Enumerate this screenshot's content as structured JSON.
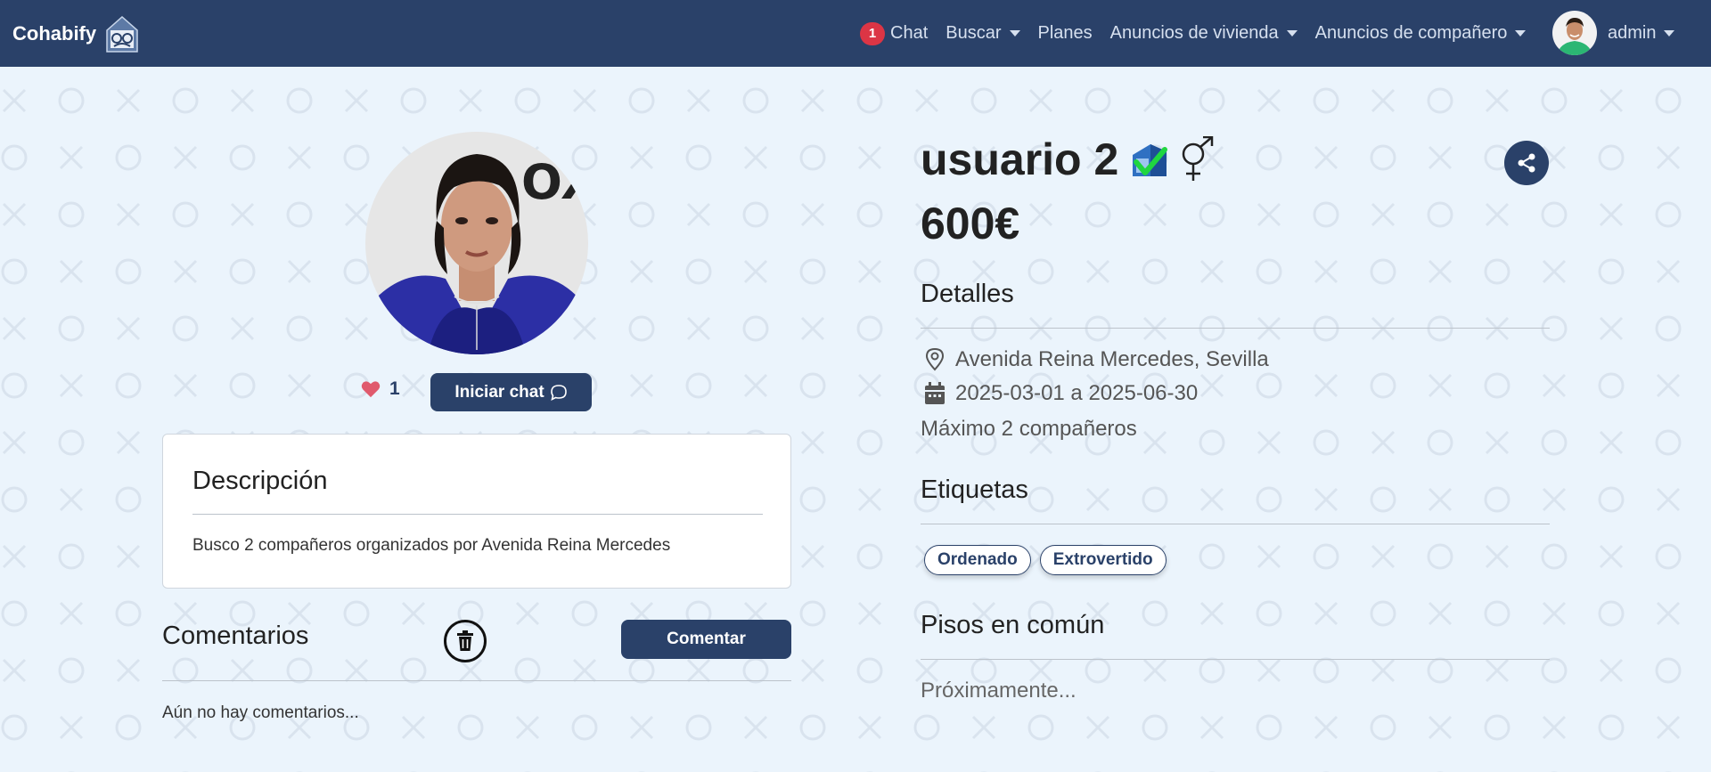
{
  "navbar": {
    "brand": "Cohabify",
    "chat_badge": "1",
    "chat_label": "Chat",
    "search_label": "Buscar",
    "plans_label": "Planes",
    "housing_ads_label": "Anuncios de vivienda",
    "roommate_ads_label": "Anuncios de compañero",
    "user_name": "admin"
  },
  "profile": {
    "likes": "1",
    "chat_button": "Iniciar chat",
    "description_title": "Descripción",
    "description_text": "Busco 2 compañeros organizados por Avenida Reina Mercedes",
    "comments_title": "Comentarios",
    "comment_button": "Comentar",
    "no_comments": "Aún no hay comentarios..."
  },
  "listing": {
    "title": "usuario 2",
    "price": "600€",
    "details_title": "Detalles",
    "location": "Avenida Reina Mercedes, Sevilla",
    "dates": "2025-03-01 a 2025-06-30",
    "max_roommates": "Máximo 2 compañeros",
    "tags_title": "Etiquetas",
    "tags": [
      "Ordenado",
      "Extrovertido"
    ],
    "shared_flats_title": "Pisos en común",
    "shared_flats_text": "Próximamente..."
  },
  "colors": {
    "primary": "#2a4169",
    "background": "#ebf4fc",
    "badge": "#dc3545",
    "heart": "#e05a6d"
  },
  "icons": [
    "verified-icon",
    "gender-icon",
    "share-icon",
    "location-icon",
    "calendar-icon",
    "heart-icon",
    "chat-bubble-icon",
    "trash-icon"
  ]
}
